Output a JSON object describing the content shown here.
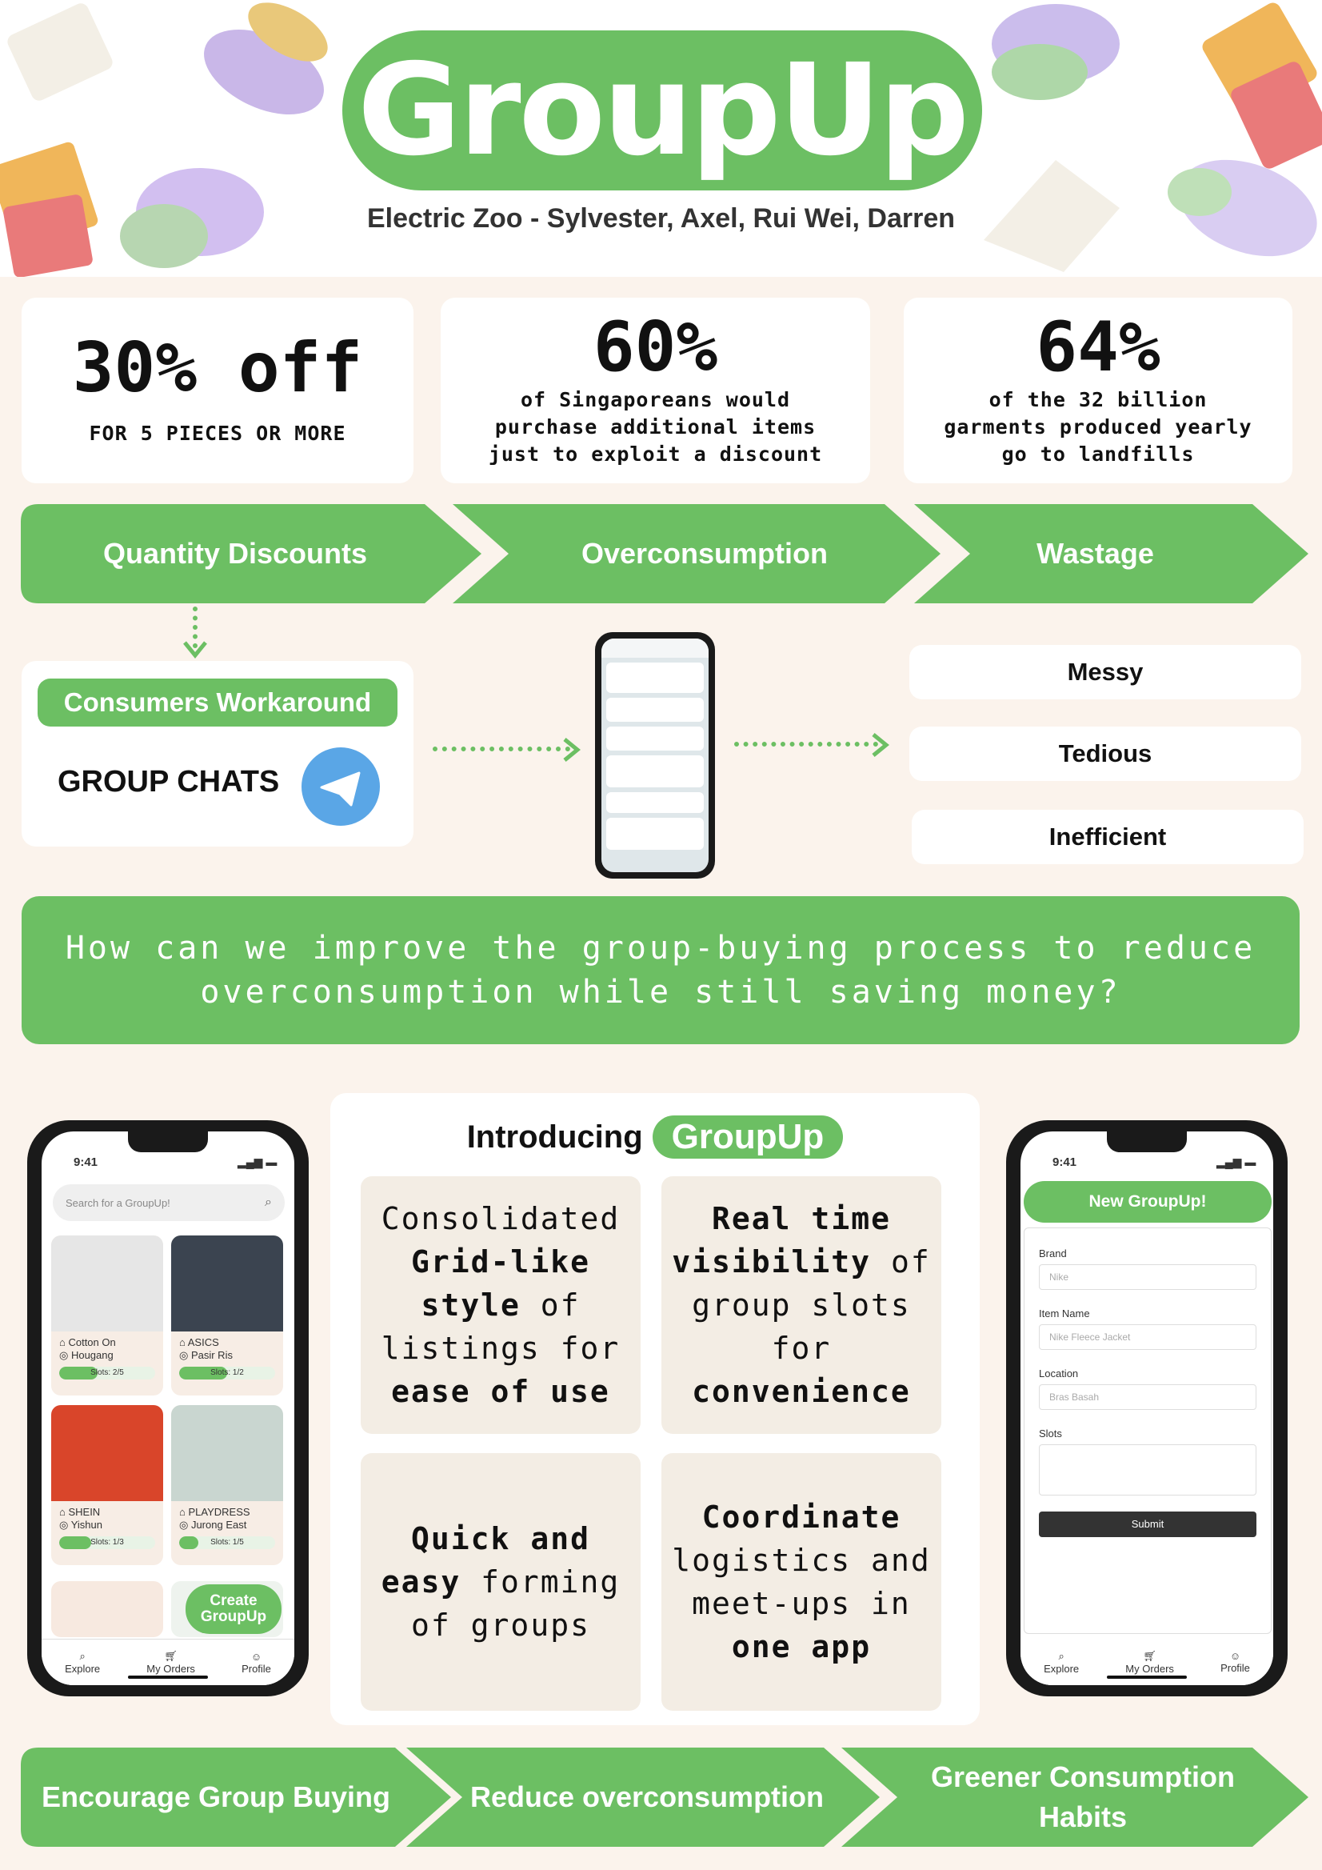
{
  "header": {
    "title": "GroupUp",
    "team": "Electric Zoo - Sylvester, Axel, Rui Wei, Darren"
  },
  "stats": [
    {
      "big": "30% off",
      "sub": "FOR 5 PIECES OR MORE"
    },
    {
      "big": "60%",
      "sub": "of Singaporeans would purchase additional items just to exploit a discount"
    },
    {
      "big": "64%",
      "sub": "of the 32 billion garments produced yearly go to landfills"
    }
  ],
  "problems": [
    "Quantity Discounts",
    "Overconsumption",
    "Wastage"
  ],
  "workaround": {
    "label": "Consumers Workaround",
    "text": "GROUP CHATS"
  },
  "issues": [
    "Messy",
    "Tedious",
    "Inefficient"
  ],
  "question": "How can we improve the group-buying process to reduce overconsumption while still saving money?",
  "intro": {
    "label": "Introducing",
    "brand": "GroupUp"
  },
  "features": [
    {
      "parts": [
        {
          "t": "Consolidated ",
          "b": false
        },
        {
          "t": "Grid-like style",
          "b": true
        },
        {
          "t": " of listings for ",
          "b": false
        },
        {
          "t": "ease of use",
          "b": true
        }
      ]
    },
    {
      "parts": [
        {
          "t": "Real time visibility",
          "b": true
        },
        {
          "t": " of group slots for ",
          "b": false
        },
        {
          "t": "convenience",
          "b": true
        }
      ]
    },
    {
      "parts": [
        {
          "t": "Quick and easy",
          "b": true
        },
        {
          "t": " forming of groups",
          "b": false
        }
      ]
    },
    {
      "parts": [
        {
          "t": "Coordinate",
          "b": true
        },
        {
          "t": " logistics and meet-ups in ",
          "b": false
        },
        {
          "t": "one app",
          "b": true
        }
      ]
    }
  ],
  "left_phone": {
    "time": "9:41",
    "search_placeholder": "Search for a GroupUp!",
    "listings": [
      {
        "brand": "Cotton On",
        "location": "Hougang",
        "slots": "Slots: 2/5",
        "fill": 0.4,
        "img": "#e6e6e6"
      },
      {
        "brand": "ASICS",
        "location": "Pasir Ris",
        "slots": "Slots: 1/2",
        "fill": 0.5,
        "img": "#3b4450"
      },
      {
        "brand": "SHEIN",
        "location": "Yishun",
        "slots": "Slots: 1/3",
        "fill": 0.33,
        "img": "#d9452a"
      },
      {
        "brand": "PLAYDRESS",
        "location": "Jurong East",
        "slots": "Slots: 1/5",
        "fill": 0.2,
        "img": "#c9d6d0"
      }
    ],
    "create_button": "Create GroupUp",
    "nav": [
      "Explore",
      "My Orders",
      "Profile"
    ]
  },
  "right_phone": {
    "time": "9:41",
    "heading": "New GroupUp!",
    "fields": [
      {
        "label": "Brand",
        "placeholder": "Nike"
      },
      {
        "label": "Item Name",
        "placeholder": "Nike Fleece Jacket"
      },
      {
        "label": "Location",
        "placeholder": "Bras Basah"
      },
      {
        "label": "Slots",
        "placeholder": ""
      }
    ],
    "submit": "Submit",
    "nav": [
      "Explore",
      "My Orders",
      "Profile"
    ]
  },
  "outcomes": [
    "Encourage Group Buying",
    "Reduce overconsumption",
    "Greener Consumption Habits"
  ],
  "colors": {
    "accent": "#6cbf63",
    "background": "#fbf3ec",
    "telegram": "#5aa6e6"
  }
}
